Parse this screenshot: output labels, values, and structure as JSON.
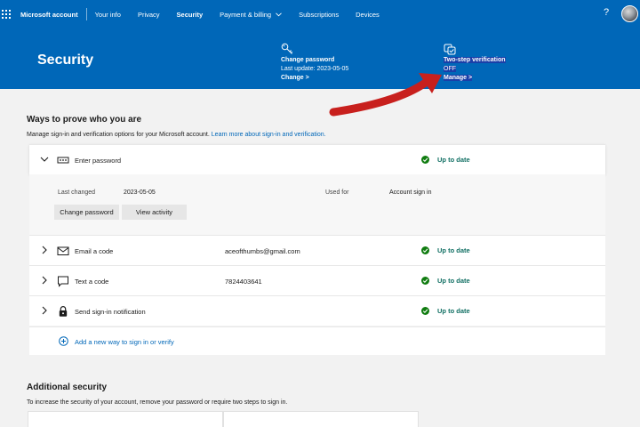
{
  "nav": {
    "brand": "Microsoft account",
    "items": [
      "Your info",
      "Privacy",
      "Security",
      "Payment & billing",
      "Subscriptions",
      "Devices"
    ],
    "active": "Security",
    "help": "?"
  },
  "hero": {
    "title": "Security",
    "change_password": {
      "title": "Change password",
      "subtitle": "Last update: 2023-05-05",
      "link": "Change >"
    },
    "two_step": {
      "title": "Two-step verification",
      "status": "OFF",
      "link": "Manage >"
    }
  },
  "ways": {
    "heading": "Ways to prove who you are",
    "description": "Manage sign-in and verification options for your Microsoft account.",
    "learn_more": "Learn more about sign-in and verification.",
    "rows": [
      {
        "label": "Enter password",
        "value": "",
        "status": "Up to date"
      },
      {
        "label": "Email a code",
        "value": "aceofthumbs@gmail.com",
        "status": "Up to date"
      },
      {
        "label": "Text a code",
        "value": "7824403641",
        "status": "Up to date"
      },
      {
        "label": "Send sign-in notification",
        "value": "",
        "status": "Up to date"
      }
    ],
    "expanded": {
      "last_changed_label": "Last changed",
      "last_changed_value": "2023-05-05",
      "used_for_label": "Used for",
      "used_for_value": "Account sign in",
      "change_button": "Change password",
      "view_button": "View activity"
    },
    "add_new": "Add a new way to sign in or verify"
  },
  "additional": {
    "heading": "Additional security",
    "description": "To increase the security of your account, remove your password or require two steps to sign in."
  },
  "colors": {
    "brand_blue": "#0067b8",
    "status_green": "#107c10",
    "arrow_red": "#c8201d"
  }
}
